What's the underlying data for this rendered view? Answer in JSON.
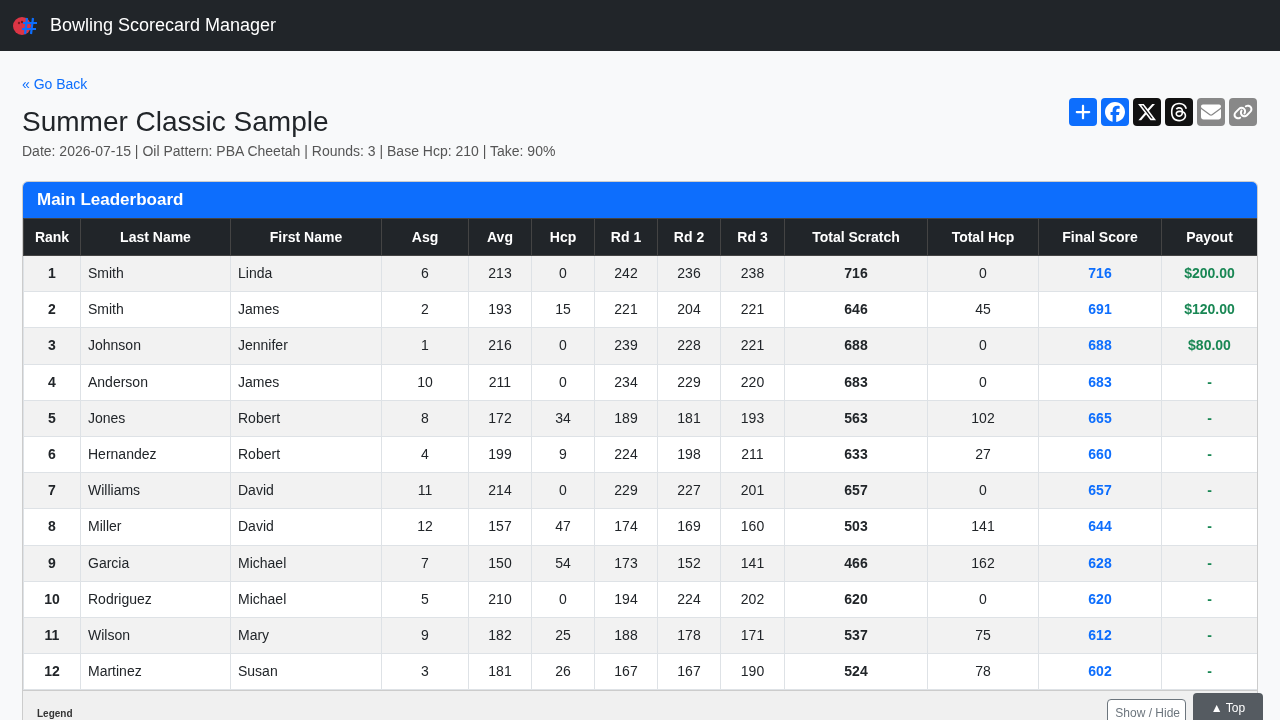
{
  "navbar": {
    "title": "Bowling Scorecard Manager"
  },
  "back_link": "« Go Back",
  "event": {
    "title": "Summer Classic Sample",
    "details": "Date: 2026-07-15 | Oil Pattern: PBA Cheetah | Rounds: 3 | Base Hcp: 210 | Take: 90%"
  },
  "share_buttons": [
    {
      "kind": "add",
      "color": "#0d6efd"
    },
    {
      "kind": "facebook",
      "color": "#0d6efd"
    },
    {
      "kind": "x",
      "color": "#111111"
    },
    {
      "kind": "threads",
      "color": "#111111"
    },
    {
      "kind": "email",
      "color": "#888888"
    },
    {
      "kind": "copy",
      "color": "#888888"
    }
  ],
  "leaderboard": {
    "title": "Main Leaderboard",
    "columns": [
      "Rank",
      "Last Name",
      "First Name",
      "Asg",
      "Avg",
      "Hcp",
      "Rd 1",
      "Rd 2",
      "Rd 3",
      "Total Scratch",
      "Total Hcp",
      "Final Score",
      "Payout"
    ],
    "rows": [
      [
        "1",
        "Smith",
        "Linda",
        "6",
        "213",
        "0",
        "242",
        "236",
        "238",
        "716",
        "0",
        "716",
        "$200.00"
      ],
      [
        "2",
        "Smith",
        "James",
        "2",
        "193",
        "15",
        "221",
        "204",
        "221",
        "646",
        "45",
        "691",
        "$120.00"
      ],
      [
        "3",
        "Johnson",
        "Jennifer",
        "1",
        "216",
        "0",
        "239",
        "228",
        "221",
        "688",
        "0",
        "688",
        "$80.00"
      ],
      [
        "4",
        "Anderson",
        "James",
        "10",
        "211",
        "0",
        "234",
        "229",
        "220",
        "683",
        "0",
        "683",
        "-"
      ],
      [
        "5",
        "Jones",
        "Robert",
        "8",
        "172",
        "34",
        "189",
        "181",
        "193",
        "563",
        "102",
        "665",
        "-"
      ],
      [
        "6",
        "Hernandez",
        "Robert",
        "4",
        "199",
        "9",
        "224",
        "198",
        "211",
        "633",
        "27",
        "660",
        "-"
      ],
      [
        "7",
        "Williams",
        "David",
        "11",
        "214",
        "0",
        "229",
        "227",
        "201",
        "657",
        "0",
        "657",
        "-"
      ],
      [
        "8",
        "Miller",
        "David",
        "12",
        "157",
        "47",
        "174",
        "169",
        "160",
        "503",
        "141",
        "644",
        "-"
      ],
      [
        "9",
        "Garcia",
        "Michael",
        "7",
        "150",
        "54",
        "173",
        "152",
        "141",
        "466",
        "162",
        "628",
        "-"
      ],
      [
        "10",
        "Rodriguez",
        "Michael",
        "5",
        "210",
        "0",
        "194",
        "224",
        "202",
        "620",
        "0",
        "620",
        "-"
      ],
      [
        "11",
        "Wilson",
        "Mary",
        "9",
        "182",
        "25",
        "188",
        "178",
        "171",
        "537",
        "75",
        "612",
        "-"
      ],
      [
        "12",
        "Martinez",
        "Susan",
        "3",
        "181",
        "26",
        "167",
        "167",
        "190",
        "524",
        "78",
        "602",
        "-"
      ]
    ]
  },
  "legend": {
    "title": "Legend",
    "toggle_button": "Show / Hide"
  },
  "top_button": "▲ Top"
}
